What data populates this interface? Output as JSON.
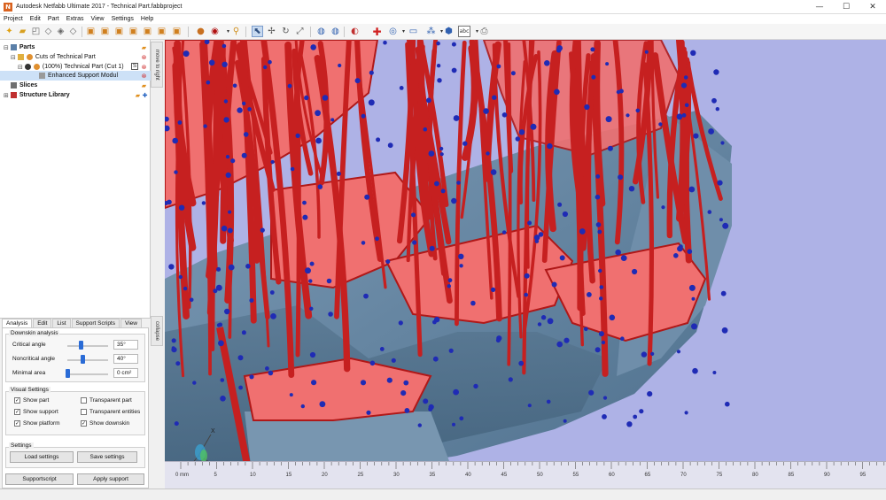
{
  "window": {
    "title": "Autodesk Netfabb Ultimate 2017 - Technical Part.fabbproject",
    "logo_letter": "N",
    "controls": [
      "—",
      "☐",
      "✕"
    ]
  },
  "menu": [
    "Project",
    "Edit",
    "Part",
    "Extras",
    "View",
    "Settings",
    "Help"
  ],
  "toolbar_icons": [
    "new-file-icon",
    "open-folder-icon",
    "save-icon",
    "import-icon",
    "measure-icon",
    "export-icon",
    "front-view-icon",
    "back-view-icon",
    "left-view-icon",
    "right-view-icon",
    "top-view-icon",
    "bottom-view-icon",
    "solid-shade-icon",
    "texture-icon",
    "search-icon",
    "select-icon",
    "move-icon",
    "rotate-icon",
    "scale-icon",
    "slice-icon",
    "repair-icon",
    "colors-icon",
    "add-support-icon",
    "analysis-icon",
    "measure-bar-icon",
    "lattice-icon",
    "view-cube-icon",
    "label-icon",
    "print-icon"
  ],
  "tree": {
    "parts_label": "Parts",
    "cuts_label": "Cuts of Technical Part",
    "part_label": "(100%) Technical Part (Cut 1)",
    "part_badge": "S",
    "support_label": "Enhanced Support Modul",
    "slices_label": "Slices",
    "structure_label": "Structure Library"
  },
  "side_tabs": {
    "move_right": "move to right",
    "collapse": "collapse"
  },
  "tabs": [
    "Analysis",
    "Edit",
    "List",
    "Support Scripts",
    "View"
  ],
  "downskin": {
    "group_title": "Downskin analysis",
    "critical_label": "Critical angle",
    "critical_value": "35°",
    "critical_level": 0.33,
    "noncritical_label": "Noncritical angle",
    "noncritical_value": "40°",
    "noncritical_level": 0.36,
    "minarea_label": "Minimal area",
    "minarea_value": "0 cm²",
    "minarea_level": 0.0
  },
  "visual": {
    "group_title": "Visual Settings",
    "items": [
      {
        "label": "Show part",
        "checked": true
      },
      {
        "label": "Show support",
        "checked": true
      },
      {
        "label": "Show platform",
        "checked": true
      },
      {
        "label": "Transparent part",
        "checked": false
      },
      {
        "label": "Transparent entities",
        "checked": false
      },
      {
        "label": "Show downskin",
        "checked": true
      }
    ]
  },
  "settings": {
    "group_title": "Settings",
    "load": "Load settings",
    "save": "Save settings"
  },
  "actions": {
    "supportscript": "Supportscript",
    "apply": "Apply support"
  },
  "ruler": {
    "unit": "0 mm",
    "ticks": [
      "5",
      "10",
      "15",
      "20",
      "25",
      "30",
      "35",
      "40",
      "45",
      "50",
      "55",
      "60",
      "65",
      "70",
      "75",
      "80",
      "85",
      "90",
      "95"
    ]
  },
  "axis": {
    "x": "X",
    "y": "y",
    "z": "z"
  },
  "colors": {
    "viewport_bg": "#aeb2e6",
    "part": "#6c8ba6",
    "support": "#c62020",
    "downskin": "#f07070",
    "points": "#1f2bb5"
  }
}
